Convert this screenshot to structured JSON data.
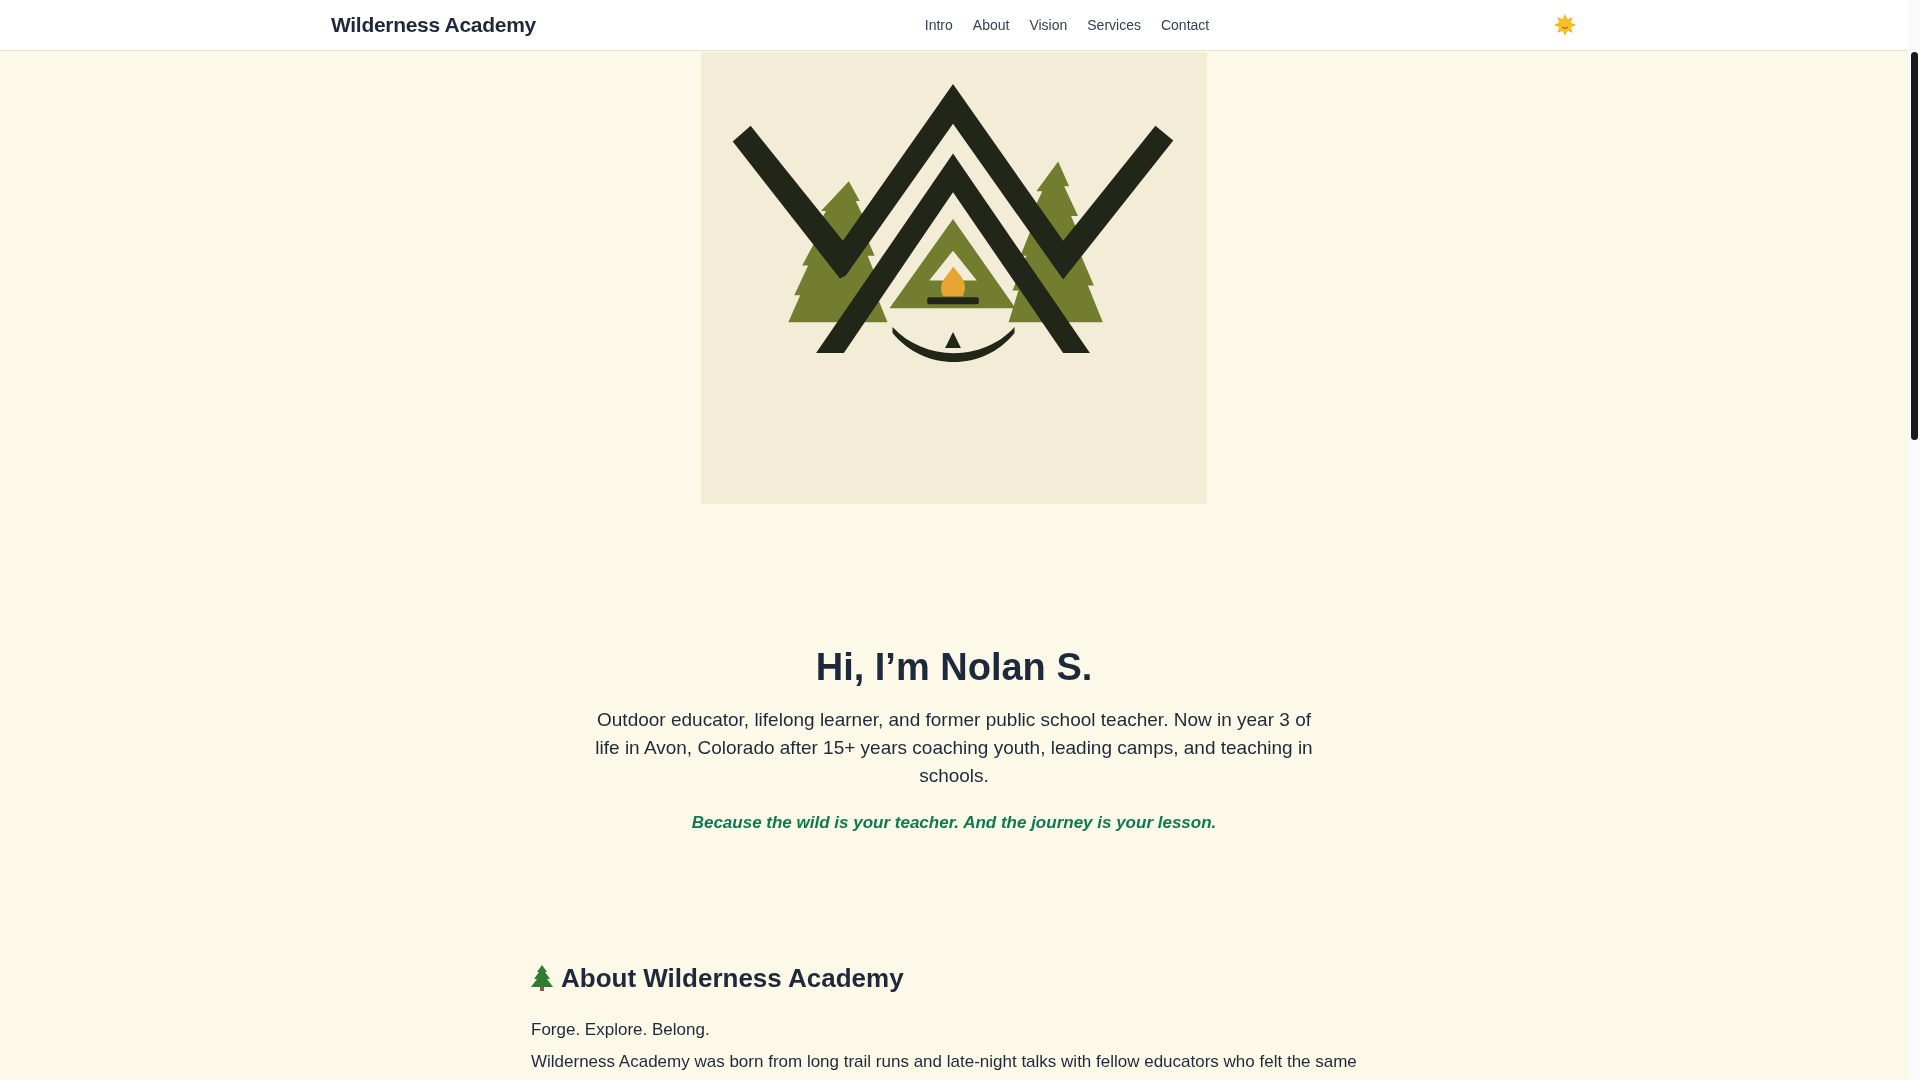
{
  "header": {
    "brand": "Wilderness Academy",
    "nav": [
      {
        "label": "Intro"
      },
      {
        "label": "About"
      },
      {
        "label": "Vision"
      },
      {
        "label": "Services"
      },
      {
        "label": "Contact"
      }
    ]
  },
  "hero": {
    "title": "Hi, I’m Nolan S.",
    "intro": "Outdoor educator, lifelong learner, and former public school teacher. Now in year 3 of life in Avon, Colorado after 15+ years coaching youth, leading camps, and teaching in schools.",
    "tagline": "Because the wild is your teacher. And the journey is your lesson."
  },
  "about": {
    "heading": "About Wilderness Academy",
    "paragraphs": [
      "Forge. Explore. Belong.",
      "Wilderness Academy was born from long trail runs and late-night talks with fellow educators who felt the same"
    ]
  }
}
